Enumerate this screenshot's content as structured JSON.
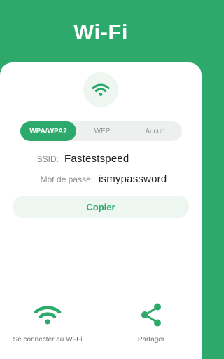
{
  "header": {
    "title": "Wi-Fi"
  },
  "icons": {
    "wifi_main": "wifi-icon",
    "wifi_connect": "wifi-icon",
    "share": "share-icon"
  },
  "security": {
    "options": [
      "WPA/WPA2",
      "WEP",
      "Aucun"
    ],
    "selected": "WPA/WPA2"
  },
  "network": {
    "ssid_label": "SSID:",
    "ssid_value": "Fastestspeed",
    "password_label": "Mot de passe:",
    "password_value": "ismypassword"
  },
  "copy_button": {
    "label": "Copier"
  },
  "actions": {
    "connect_label": "Se connecter au Wi-Fi",
    "share_label": "Partager"
  },
  "colors": {
    "accent": "#2daa6b",
    "accent_light": "#eef6f1",
    "segment_bg": "#eef0ef",
    "label_gray": "#8c8c8c"
  }
}
